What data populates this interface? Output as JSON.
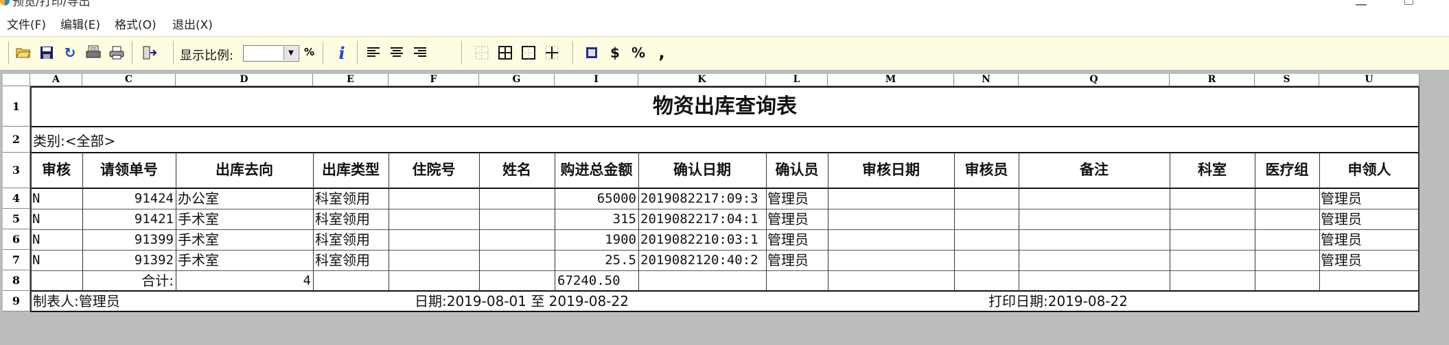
{
  "window": {
    "title": "预览/打印/导出"
  },
  "menu": [
    {
      "label": "文件(F)"
    },
    {
      "label": "编辑(E)"
    },
    {
      "label": "格式(O)"
    },
    {
      "label": "退出(X)"
    }
  ],
  "toolbar": {
    "zoom_label": "显示比例:",
    "zoom_value": "",
    "percent_sign": "%",
    "tools": [
      {
        "icon": "folder-open-icon",
        "glyph": "📂"
      },
      {
        "icon": "save-icon",
        "glyph": "💾"
      },
      {
        "icon": "refresh-icon",
        "glyph": "↻"
      },
      {
        "icon": "print-preview-icon",
        "glyph": "▤"
      },
      {
        "icon": "printer-icon",
        "glyph": "⎙"
      },
      {
        "icon": "export-icon",
        "glyph": "⇥"
      },
      {
        "icon": "info-icon",
        "glyph": "i"
      },
      {
        "icon": "align-left-icon",
        "glyph": "≡"
      },
      {
        "icon": "align-center-icon",
        "glyph": "≡"
      },
      {
        "icon": "align-right-icon",
        "glyph": "≡"
      },
      {
        "icon": "border-none-icon",
        "glyph": "⊞"
      },
      {
        "icon": "border-all-icon",
        "glyph": "⊞"
      },
      {
        "icon": "border-outer-icon",
        "glyph": "□"
      },
      {
        "icon": "border-inner-icon",
        "glyph": "┼"
      },
      {
        "icon": "format-general-icon",
        "glyph": "▦"
      },
      {
        "icon": "format-currency-icon",
        "glyph": "$"
      },
      {
        "icon": "format-percent-icon",
        "glyph": "%"
      },
      {
        "icon": "format-comma-icon",
        "glyph": ","
      }
    ]
  },
  "columns": [
    "A",
    "C",
    "D",
    "E",
    "F",
    "G",
    "I",
    "K",
    "L",
    "M",
    "N",
    "Q",
    "R",
    "S",
    "U"
  ],
  "rows": [
    "1",
    "2",
    "3",
    "4",
    "5",
    "6",
    "7",
    "8",
    "9"
  ],
  "report": {
    "title": "物资出库查询表",
    "category": "类别:<全部>",
    "headers": [
      "审核",
      "请领单号",
      "出库去向",
      "出库类型",
      "住院号",
      "姓名",
      "购进总金额",
      "确认日期",
      "确认员",
      "审核日期",
      "审核员",
      "备注",
      "科室",
      "医疗组",
      "申领人"
    ],
    "records": [
      {
        "audit": "N",
        "no": "91424",
        "dest": "办公室",
        "type": "科室领用",
        "amount": "65000",
        "confirm_date": "2019082217:09:3",
        "confirmer": "管理员",
        "applicant": "管理员"
      },
      {
        "audit": "N",
        "no": "91421",
        "dest": "手术室",
        "type": "科室领用",
        "amount": "315",
        "confirm_date": "2019082217:04:1",
        "confirmer": "管理员",
        "applicant": "管理员"
      },
      {
        "audit": "N",
        "no": "91399",
        "dest": "手术室",
        "type": "科室领用",
        "amount": "1900",
        "confirm_date": "2019082210:03:1",
        "confirmer": "管理员",
        "applicant": "管理员"
      },
      {
        "audit": "N",
        "no": "91392",
        "dest": "手术室",
        "type": "科室领用",
        "amount": "25.5",
        "confirm_date": "2019082120:40:2",
        "confirmer": "管理员",
        "applicant": "管理员"
      }
    ],
    "total_label": "合计:",
    "total_count": "4",
    "total_amount": "67240.50",
    "maker": "制表人:管理员",
    "date_range": "日期:2019-08-01 至 2019-08-22",
    "print_date": "打印日期:2019-08-22"
  }
}
